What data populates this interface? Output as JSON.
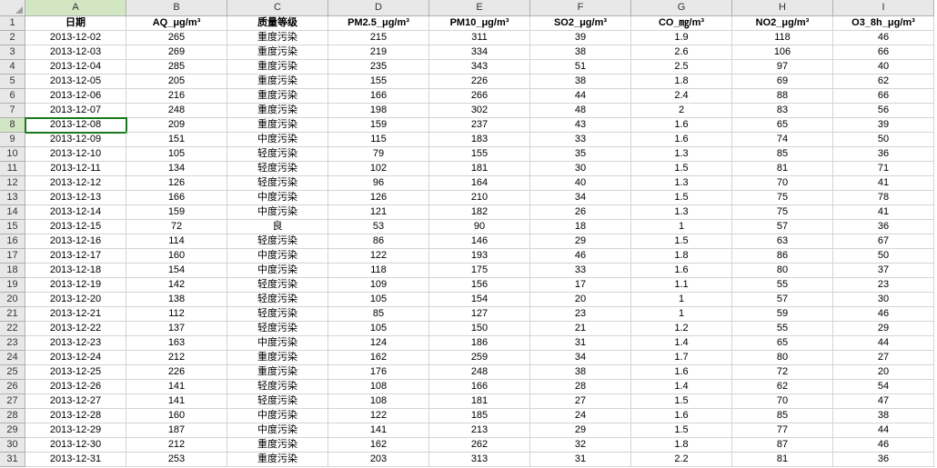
{
  "columns": [
    "A",
    "B",
    "C",
    "D",
    "E",
    "F",
    "G",
    "H",
    "I"
  ],
  "headers": [
    "日期",
    "AQ_μg/m³",
    "质量等级",
    "PM2.5_μg/m³",
    "PM10_μg/m³",
    "SO2_μg/m³",
    "CO_㎎/m³",
    "NO2_μg/m³",
    "O3_8h_μg/m³"
  ],
  "active_cell": {
    "row": 8,
    "col": 0
  },
  "rows": [
    [
      "2013-12-02",
      "265",
      "重度污染",
      "215",
      "311",
      "39",
      "1.9",
      "118",
      "46"
    ],
    [
      "2013-12-03",
      "269",
      "重度污染",
      "219",
      "334",
      "38",
      "2.6",
      "106",
      "66"
    ],
    [
      "2013-12-04",
      "285",
      "重度污染",
      "235",
      "343",
      "51",
      "2.5",
      "97",
      "40"
    ],
    [
      "2013-12-05",
      "205",
      "重度污染",
      "155",
      "226",
      "38",
      "1.8",
      "69",
      "62"
    ],
    [
      "2013-12-06",
      "216",
      "重度污染",
      "166",
      "266",
      "44",
      "2.4",
      "88",
      "66"
    ],
    [
      "2013-12-07",
      "248",
      "重度污染",
      "198",
      "302",
      "48",
      "2",
      "83",
      "56"
    ],
    [
      "2013-12-08",
      "209",
      "重度污染",
      "159",
      "237",
      "43",
      "1.6",
      "65",
      "39"
    ],
    [
      "2013-12-09",
      "151",
      "中度污染",
      "115",
      "183",
      "33",
      "1.6",
      "74",
      "50"
    ],
    [
      "2013-12-10",
      "105",
      "轻度污染",
      "79",
      "155",
      "35",
      "1.3",
      "85",
      "36"
    ],
    [
      "2013-12-11",
      "134",
      "轻度污染",
      "102",
      "181",
      "30",
      "1.5",
      "81",
      "71"
    ],
    [
      "2013-12-12",
      "126",
      "轻度污染",
      "96",
      "164",
      "40",
      "1.3",
      "70",
      "41"
    ],
    [
      "2013-12-13",
      "166",
      "中度污染",
      "126",
      "210",
      "34",
      "1.5",
      "75",
      "78"
    ],
    [
      "2013-12-14",
      "159",
      "中度污染",
      "121",
      "182",
      "26",
      "1.3",
      "75",
      "41"
    ],
    [
      "2013-12-15",
      "72",
      "良",
      "53",
      "90",
      "18",
      "1",
      "57",
      "36"
    ],
    [
      "2013-12-16",
      "114",
      "轻度污染",
      "86",
      "146",
      "29",
      "1.5",
      "63",
      "67"
    ],
    [
      "2013-12-17",
      "160",
      "中度污染",
      "122",
      "193",
      "46",
      "1.8",
      "86",
      "50"
    ],
    [
      "2013-12-18",
      "154",
      "中度污染",
      "118",
      "175",
      "33",
      "1.6",
      "80",
      "37"
    ],
    [
      "2013-12-19",
      "142",
      "轻度污染",
      "109",
      "156",
      "17",
      "1.1",
      "55",
      "23"
    ],
    [
      "2013-12-20",
      "138",
      "轻度污染",
      "105",
      "154",
      "20",
      "1",
      "57",
      "30"
    ],
    [
      "2013-12-21",
      "112",
      "轻度污染",
      "85",
      "127",
      "23",
      "1",
      "59",
      "46"
    ],
    [
      "2013-12-22",
      "137",
      "轻度污染",
      "105",
      "150",
      "21",
      "1.2",
      "55",
      "29"
    ],
    [
      "2013-12-23",
      "163",
      "中度污染",
      "124",
      "186",
      "31",
      "1.4",
      "65",
      "44"
    ],
    [
      "2013-12-24",
      "212",
      "重度污染",
      "162",
      "259",
      "34",
      "1.7",
      "80",
      "27"
    ],
    [
      "2013-12-25",
      "226",
      "重度污染",
      "176",
      "248",
      "38",
      "1.6",
      "72",
      "20"
    ],
    [
      "2013-12-26",
      "141",
      "轻度污染",
      "108",
      "166",
      "28",
      "1.4",
      "62",
      "54"
    ],
    [
      "2013-12-27",
      "141",
      "轻度污染",
      "108",
      "181",
      "27",
      "1.5",
      "70",
      "47"
    ],
    [
      "2013-12-28",
      "160",
      "中度污染",
      "122",
      "185",
      "24",
      "1.6",
      "85",
      "38"
    ],
    [
      "2013-12-29",
      "187",
      "中度污染",
      "141",
      "213",
      "29",
      "1.5",
      "77",
      "44"
    ],
    [
      "2013-12-30",
      "212",
      "重度污染",
      "162",
      "262",
      "32",
      "1.8",
      "87",
      "46"
    ],
    [
      "2013-12-31",
      "253",
      "重度污染",
      "203",
      "313",
      "31",
      "2.2",
      "81",
      "36"
    ]
  ]
}
